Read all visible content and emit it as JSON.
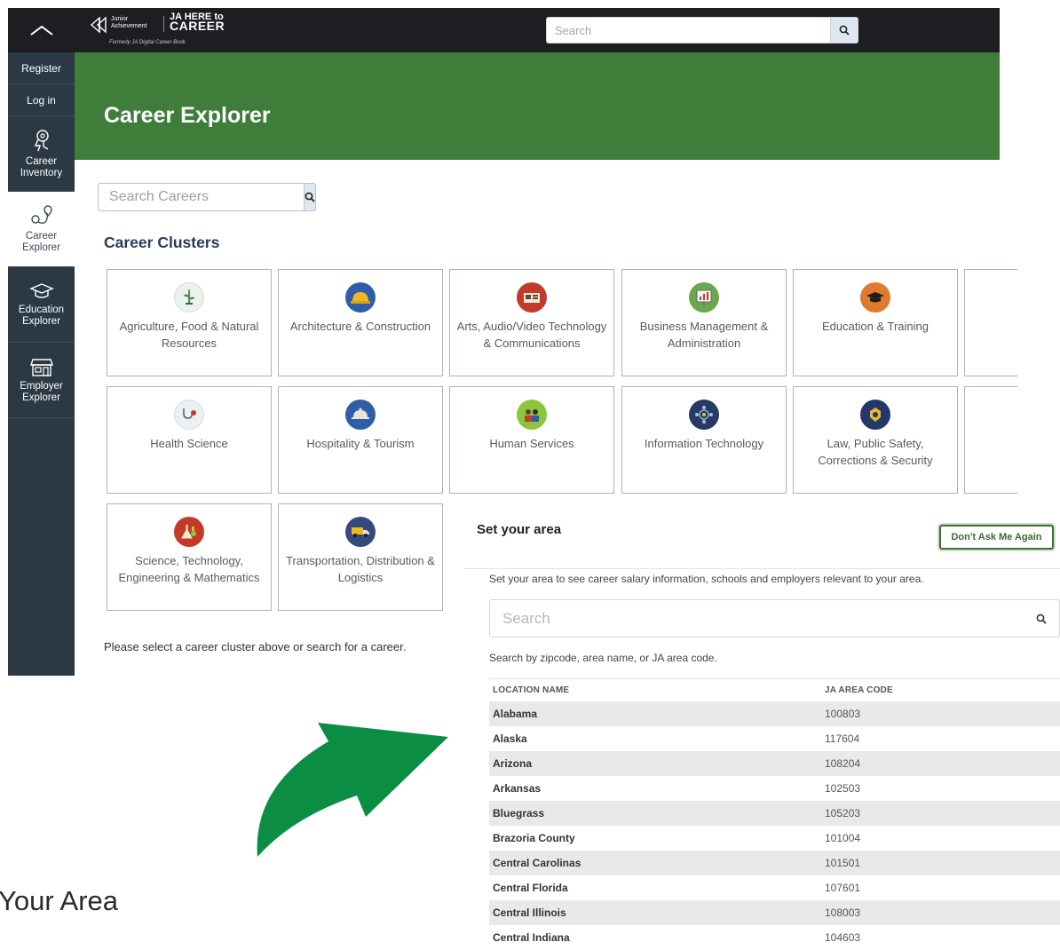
{
  "topbar": {
    "logo_org": "Junior Achievement",
    "logo_brand_line1": "JA HERE to",
    "logo_brand_line2": "CAREER",
    "logo_formerly": "Formerly JA Digital Career Book",
    "search_placeholder": "Search"
  },
  "sidebar": {
    "register": "Register",
    "login": "Log in",
    "items": [
      {
        "label_1": "Career",
        "label_2": "Inventory",
        "icon": "brain-icon"
      },
      {
        "label_1": "Career",
        "label_2": "Explorer",
        "icon": "map-path-icon"
      },
      {
        "label_1": "Education",
        "label_2": "Explorer",
        "icon": "graduation-cap-icon"
      },
      {
        "label_1": "Employer",
        "label_2": "Explorer",
        "icon": "storefront-icon"
      }
    ],
    "active_index": 1
  },
  "banner": {
    "title": "Career Explorer"
  },
  "career_search": {
    "placeholder": "Search Careers"
  },
  "clusters": {
    "title": "Career Clusters",
    "items": [
      {
        "label": "Agriculture, Food & Natural Resources",
        "icon": "plant-icon",
        "color": "#ecf1ee"
      },
      {
        "label": "Architecture & Construction",
        "icon": "hardhat-icon",
        "color": "#2f5ea8"
      },
      {
        "label": "Arts, Audio/Video Technology & Communications",
        "icon": "film-icon",
        "color": "#c33a2b"
      },
      {
        "label": "Business Management & Administration",
        "icon": "chart-board-icon",
        "color": "#6aa84f"
      },
      {
        "label": "Education & Training",
        "icon": "mortarboard-icon",
        "color": "#e07a2e"
      },
      {
        "label": "Health Science",
        "icon": "stethoscope-icon",
        "color": "#ecf0f3"
      },
      {
        "label": "Hospitality & Tourism",
        "icon": "cloche-icon",
        "color": "#2f5ea8"
      },
      {
        "label": "Human Services",
        "icon": "people-icon",
        "color": "#8cc63f"
      },
      {
        "label": "Information Technology",
        "icon": "network-icon",
        "color": "#263a63"
      },
      {
        "label": "Law, Public Safety, Corrections & Security",
        "icon": "badge-icon",
        "color": "#22386b"
      },
      {
        "label": "Science, Technology, Engineering & Mathematics",
        "icon": "flask-icon",
        "color": "#c33a2b"
      },
      {
        "label": "Transportation, Distribution & Logistics",
        "icon": "truck-icon",
        "color": "#35497c"
      }
    ],
    "hint": "Please select a career cluster above or search for a career."
  },
  "area_modal": {
    "title": "Set your area",
    "dont_ask_button": "Don't Ask Me Again",
    "description": "Set your area to see career salary information, schools and employers relevant to your area.",
    "search_placeholder": "Search",
    "search_hint": "Search by zipcode, area name, or JA area code.",
    "columns": [
      "LOCATION NAME",
      "JA AREA CODE"
    ],
    "rows": [
      {
        "name": "Alabama",
        "code": "100803"
      },
      {
        "name": "Alaska",
        "code": "117604"
      },
      {
        "name": "Arizona",
        "code": "108204"
      },
      {
        "name": "Arkansas",
        "code": "102503"
      },
      {
        "name": "Bluegrass",
        "code": "105203"
      },
      {
        "name": "Brazoria County",
        "code": "101004"
      },
      {
        "name": "Central Carolinas",
        "code": "101501"
      },
      {
        "name": "Central Florida",
        "code": "107601"
      },
      {
        "name": "Central Illinois",
        "code": "108003"
      },
      {
        "name": "Central Indiana",
        "code": "104603"
      }
    ]
  },
  "caption": "Your Area",
  "colors": {
    "topbar": "#1c1e22",
    "sidebar": "#2b3944",
    "banner": "#3e7d3a",
    "arrow": "#0b8e43",
    "heading": "#2e3a5c"
  }
}
